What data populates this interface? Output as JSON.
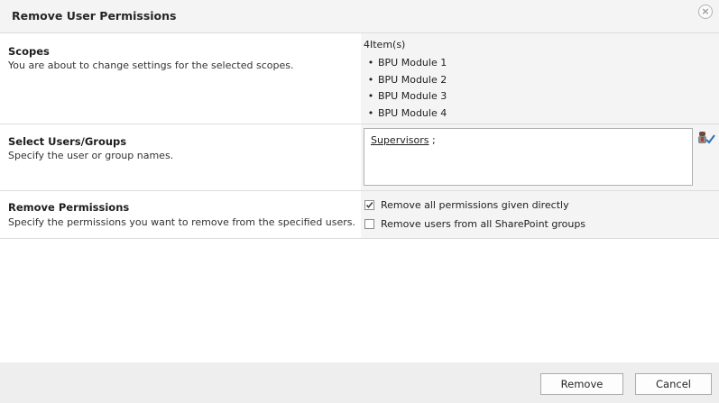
{
  "dialog": {
    "title": "Remove User Permissions",
    "close_glyph": "×"
  },
  "scopes": {
    "title": "Scopes",
    "description": "You are about to change settings for the selected scopes.",
    "count_label": "4Item(s)",
    "items": [
      "BPU Module 1",
      "BPU Module 2",
      "BPU Module 3",
      "BPU Module 4"
    ]
  },
  "users": {
    "title": "Select Users/Groups",
    "description": "Specify the user or group names.",
    "entry": "Supervisors",
    "separator": ";",
    "check_icon": "check-names-icon"
  },
  "permissions": {
    "title": "Remove Permissions",
    "description": "Specify the permissions you want to remove from the specified users.",
    "options": [
      {
        "label": "Remove all permissions given directly",
        "checked": true
      },
      {
        "label": "Remove users from all SharePoint groups",
        "checked": false
      }
    ]
  },
  "footer": {
    "remove_label": "Remove",
    "cancel_label": "Cancel"
  },
  "colors": {
    "check_accent": "#2a6ebb"
  }
}
